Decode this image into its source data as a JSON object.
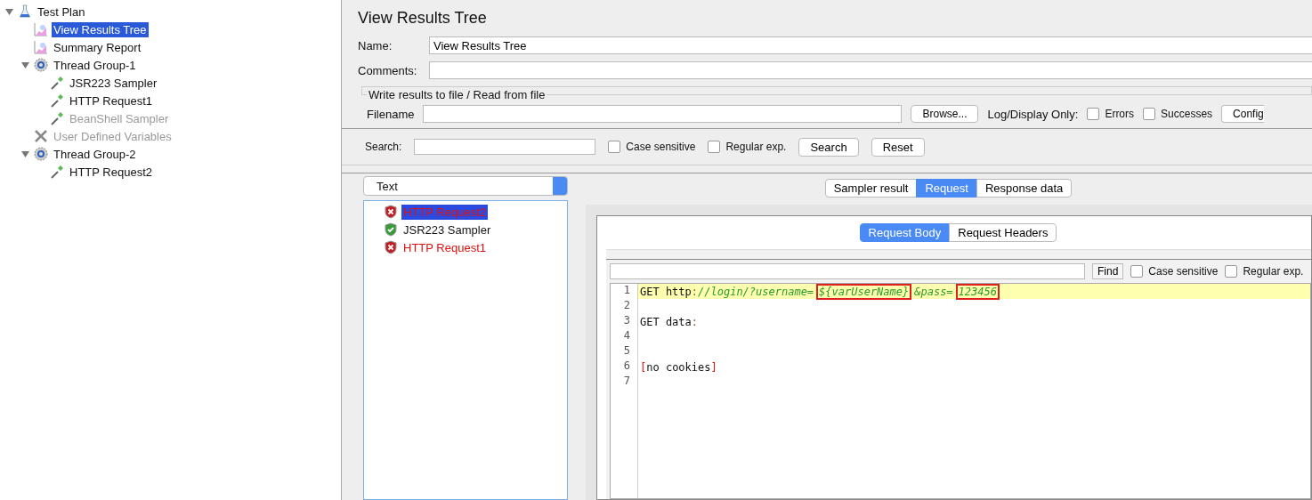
{
  "tree": [
    {
      "label": "Test Plan",
      "kind": "flask",
      "expanded": true,
      "selected": false,
      "disabled": false,
      "children": [
        {
          "label": "View Results Tree",
          "kind": "graph",
          "selected": true,
          "disabled": false
        },
        {
          "label": "Summary Report",
          "kind": "graph",
          "selected": false,
          "disabled": false
        },
        {
          "label": "Thread Group-1",
          "kind": "gear",
          "expanded": true,
          "selected": false,
          "disabled": false,
          "children": [
            {
              "label": "JSR223 Sampler",
              "kind": "dropper",
              "selected": false,
              "disabled": false
            },
            {
              "label": "HTTP Request1",
              "kind": "dropper",
              "selected": false,
              "disabled": false
            },
            {
              "label": "BeanShell Sampler",
              "kind": "dropper",
              "selected": false,
              "disabled": true
            }
          ]
        },
        {
          "label": "User Defined Variables",
          "kind": "wrench",
          "selected": false,
          "disabled": true
        },
        {
          "label": "Thread Group-2",
          "kind": "gear",
          "expanded": true,
          "selected": false,
          "disabled": false,
          "children": [
            {
              "label": "HTTP Request2",
              "kind": "dropper",
              "selected": false,
              "disabled": false
            }
          ]
        }
      ]
    }
  ],
  "panel": {
    "title": "View Results Tree",
    "name_label": "Name:",
    "name_value": "View Results Tree",
    "comments_label": "Comments:",
    "file_group": {
      "legend": "Write results to file / Read from file",
      "filename_label": "Filename",
      "browse": "Browse...",
      "log_label": "Log/Display Only:",
      "options": [
        {
          "label": "Errors",
          "checked": false
        },
        {
          "label": "Successes",
          "checked": false
        }
      ],
      "configure": "Config"
    }
  },
  "search": {
    "label": "Search:",
    "options": [
      {
        "label": "Case sensitive",
        "checked": false
      },
      {
        "label": "Regular exp.",
        "checked": false
      }
    ],
    "search_button": "Search",
    "reset_button": "Reset"
  },
  "renderer": "Text",
  "results": [
    {
      "label": "HTTP Request2",
      "kind": "fail",
      "selected": true
    },
    {
      "label": "JSR223 Sampler",
      "kind": "pass",
      "selected": false
    },
    {
      "label": "HTTP Request1",
      "kind": "fail",
      "selected": false
    }
  ],
  "tabs": [
    {
      "label": "Sampler result",
      "selected": false
    },
    {
      "label": "Request",
      "selected": true
    },
    {
      "label": "Response data",
      "selected": false
    }
  ],
  "sub_tabs": [
    {
      "label": "Request Body",
      "selected": true
    },
    {
      "label": "Request Headers",
      "selected": false
    }
  ],
  "find": {
    "button": "Find",
    "options": [
      {
        "label": "Case sensitive",
        "checked": false
      },
      {
        "label": "Regular exp.",
        "checked": false
      }
    ]
  },
  "code": [
    {
      "number": "1",
      "current": true,
      "segments": [
        {
          "text": "GET http",
          "kind": "plain"
        },
        {
          "text": ":",
          "kind": "punct"
        },
        {
          "text": "//login/?username=",
          "kind": "url"
        },
        {
          "text": "${varUserName}",
          "kind": "url",
          "boxed": true
        },
        {
          "text": "&pass=",
          "kind": "url"
        },
        {
          "text": "123456",
          "kind": "url",
          "boxed": true
        }
      ]
    },
    {
      "number": "2",
      "current": false
    },
    {
      "number": "3",
      "current": false,
      "segments": [
        {
          "text": "GET data",
          "kind": "plain"
        },
        {
          "text": ":",
          "kind": "punct"
        }
      ]
    },
    {
      "number": "4",
      "current": false
    },
    {
      "number": "5",
      "current": false
    },
    {
      "number": "6",
      "current": false,
      "segments": [
        {
          "text": "[",
          "kind": "bracket"
        },
        {
          "text": "no cookies",
          "kind": "plain"
        },
        {
          "text": "]",
          "kind": "bracket"
        }
      ]
    },
    {
      "number": "7",
      "current": false
    }
  ]
}
